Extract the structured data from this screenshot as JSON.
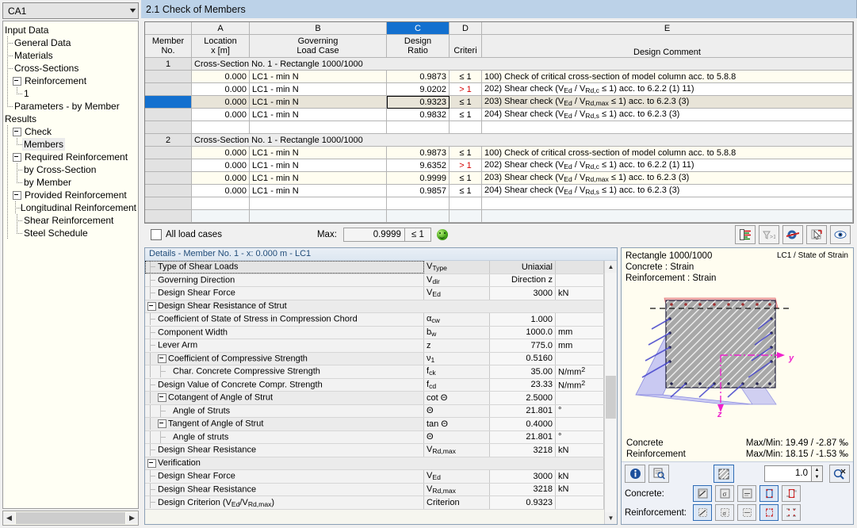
{
  "sidebar": {
    "combo_value": "CA1",
    "tree": [
      {
        "label": "Input Data",
        "level": 0,
        "guide": "none",
        "expander": false
      },
      {
        "label": "General Data",
        "level": 1,
        "guide": "tee",
        "expander": false
      },
      {
        "label": "Materials",
        "level": 1,
        "guide": "tee",
        "expander": false
      },
      {
        "label": "Cross-Sections",
        "level": 1,
        "guide": "tee",
        "expander": false
      },
      {
        "label": "Reinforcement",
        "level": 1,
        "guide": "exp",
        "expander": true
      },
      {
        "label": "1",
        "level": 2,
        "guide": "ell",
        "expander": false
      },
      {
        "label": "Parameters - by Member",
        "level": 1,
        "guide": "ell",
        "expander": false
      },
      {
        "label": "Results",
        "level": 0,
        "guide": "none",
        "expander": false
      },
      {
        "label": "Check",
        "level": 1,
        "guide": "exp",
        "expander": true
      },
      {
        "label": "Members",
        "level": 2,
        "guide": "ell",
        "expander": false,
        "selected": true
      },
      {
        "label": "Required Reinforcement",
        "level": 1,
        "guide": "exp",
        "expander": true
      },
      {
        "label": "by Cross-Section",
        "level": 2,
        "guide": "tee",
        "expander": false
      },
      {
        "label": "by Member",
        "level": 2,
        "guide": "ell",
        "expander": false
      },
      {
        "label": "Provided Reinforcement",
        "level": 1,
        "guide": "exp",
        "expander": true
      },
      {
        "label": "Longitudinal Reinforcement",
        "level": 2,
        "guide": "tee",
        "expander": false
      },
      {
        "label": "Shear Reinforcement",
        "level": 2,
        "guide": "tee",
        "expander": false
      },
      {
        "label": "Steel Schedule",
        "level": 2,
        "guide": "ell",
        "expander": false
      }
    ]
  },
  "main": {
    "tab_title": "2.1 Check of Members"
  },
  "grid": {
    "column_letters": [
      "",
      "A",
      "B",
      "C",
      "D",
      "E"
    ],
    "active_letter": "C",
    "headers": [
      {
        "l1": "Member",
        "l2": "No."
      },
      {
        "l1": "Location",
        "l2": "x [m]"
      },
      {
        "l1": "Governing",
        "l2": "Load Case"
      },
      {
        "l1": "Design",
        "l2": "Ratio"
      },
      {
        "l1": "",
        "l2": "Criteri"
      },
      {
        "l1": "",
        "l2": "Design Comment"
      }
    ],
    "groups": [
      {
        "member_no": "1",
        "group_label": "Cross-Section No. 1 - Rectangle 1000/1000",
        "rows": [
          {
            "loc": "0.000",
            "lc": "LC1 - min N",
            "ratio": "0.9873",
            "crit": "≤ 1",
            "fail": false,
            "comment_no": "100)",
            "comment": "Check of critical cross-section of model column acc. to 5.8.8",
            "comment_html": "100) Check of critical cross-section of model column acc. to 5.8.8"
          },
          {
            "loc": "0.000",
            "lc": "LC1 - min N",
            "ratio": "9.0202",
            "crit": "> 1",
            "fail": true,
            "comment_no": "202)",
            "comment": "Shear check (VEd / VRd,c ≤ 1) acc. to 6.2.2 (1) 11)",
            "comment_html": "202) Shear check (V<span class=\"sub\">Ed</span> / V<span class=\"sub\">Rd,c</span> ≤ 1) acc. to 6.2.2 (1) 11)"
          },
          {
            "loc": "0.000",
            "lc": "LC1 - min N",
            "ratio": "0.9323",
            "crit": "≤ 1",
            "fail": false,
            "selected": true,
            "comment_no": "203)",
            "comment": "Shear check  (VEd / VRd,max ≤ 1) acc. to 6.2.3 (3)",
            "comment_html": "203) Shear check  (V<span class=\"sub\">Ed</span> / V<span class=\"sub\">Rd,max</span> ≤ 1) acc. to 6.2.3 (3)"
          },
          {
            "loc": "0.000",
            "lc": "LC1 - min N",
            "ratio": "0.9832",
            "crit": "≤ 1",
            "fail": false,
            "comment_no": "204)",
            "comment": "Shear check (VEd / VRd,s ≤ 1) acc. to 6.2.3 (3)",
            "comment_html": "204) Shear check (V<span class=\"sub\">Ed</span> / V<span class=\"sub\">Rd,s</span> ≤ 1) acc. to 6.2.3 (3)"
          }
        ]
      },
      {
        "member_no": "2",
        "group_label": "Cross-Section No. 1 - Rectangle 1000/1000",
        "rows": [
          {
            "loc": "0.000",
            "lc": "LC1 - min N",
            "ratio": "0.9873",
            "crit": "≤ 1",
            "fail": false,
            "comment_no": "100)",
            "comment": "Check of critical cross-section of model column acc. to 5.8.8",
            "comment_html": "100) Check of critical cross-section of model column acc. to 5.8.8"
          },
          {
            "loc": "0.000",
            "lc": "LC1 - min N",
            "ratio": "9.6352",
            "crit": "> 1",
            "fail": true,
            "comment_no": "202)",
            "comment": "Shear check (VEd / VRd,c ≤ 1) acc. to 6.2.2 (1) 11)",
            "comment_html": "202) Shear check (V<span class=\"sub\">Ed</span> / V<span class=\"sub\">Rd,c</span> ≤ 1) acc. to 6.2.2 (1) 11)"
          },
          {
            "loc": "0.000",
            "lc": "LC1 - min N",
            "ratio": "0.9999",
            "crit": "≤ 1",
            "fail": false,
            "comment_no": "203)",
            "comment": "Shear check  (VEd / VRd,max ≤ 1) acc. to 6.2.3 (3)",
            "comment_html": "203) Shear check  (V<span class=\"sub\">Ed</span> / V<span class=\"sub\">Rd,max</span> ≤ 1) acc. to 6.2.3 (3)"
          },
          {
            "loc": "0.000",
            "lc": "LC1 - min N",
            "ratio": "0.9857",
            "crit": "≤ 1",
            "fail": false,
            "comment_no": "204)",
            "comment": "Shear check (VEd / VRd,s ≤ 1) acc. to 6.2.3 (3)",
            "comment_html": "204) Shear check (V<span class=\"sub\">Ed</span> / V<span class=\"sub\">Rd,s</span> ≤ 1) acc. to 6.2.3 (3)"
          }
        ]
      }
    ]
  },
  "gridfoot": {
    "all_load_cases_label": "All load cases",
    "all_load_cases_checked": false,
    "max_label": "Max:",
    "max_value": "0.9999",
    "max_criterion": "≤ 1"
  },
  "details": {
    "title": "Details  -  Member No. 1  -  x: 0.000 m  -  LC1",
    "rows": [
      {
        "kind": "leaf",
        "indent": 1,
        "name": "Type of Shear Loads",
        "sym": "VType",
        "sym_html": "V<span class=\"sub\">Type</span>",
        "val": "Uniaxial",
        "unit": "",
        "selected": true,
        "dotted": true
      },
      {
        "kind": "leaf",
        "indent": 1,
        "name": "Governing Direction",
        "sym": "Vdir",
        "sym_html": "V<span class=\"sub\">dir</span>",
        "val": "Direction z",
        "unit": ""
      },
      {
        "kind": "leaf",
        "indent": 1,
        "name": "Design Shear Force",
        "sym": "VEd",
        "sym_html": "V<span class=\"sub\">Ed</span>",
        "val": "3000",
        "unit": "kN"
      },
      {
        "kind": "group",
        "indent": 0,
        "name": "Design Shear Resistance of Strut",
        "sym": "",
        "val": "",
        "unit": ""
      },
      {
        "kind": "leaf",
        "indent": 1,
        "name": "Coefficient of State of Stress in Compression Chord",
        "sym": "αcw",
        "sym_html": "α<span class=\"sub\">cw</span>",
        "val": "1.000",
        "unit": ""
      },
      {
        "kind": "leaf",
        "indent": 1,
        "name": "Component Width",
        "sym": "bw",
        "sym_html": "b<span class=\"sub\">w</span>",
        "val": "1000.0",
        "unit": "mm"
      },
      {
        "kind": "leaf",
        "indent": 1,
        "name": "Lever Arm",
        "sym": "z",
        "sym_html": "z",
        "val": "775.0",
        "unit": "mm"
      },
      {
        "kind": "group",
        "indent": 1,
        "name": "Coefficient of Compressive Strength",
        "sym": "ν1",
        "sym_html": "ν<span class=\"sub\">1</span>",
        "val": "0.5160",
        "unit": ""
      },
      {
        "kind": "leaf",
        "indent": 2,
        "name": "Char. Concrete Compressive Strength",
        "sym": "fck",
        "sym_html": "f<span class=\"sub\">ck</span>",
        "val": "35.00",
        "unit": "N/mm2",
        "unit_html": "N/mm<span class=\"sup\">2</span>"
      },
      {
        "kind": "leaf",
        "indent": 1,
        "name": "Design Value of Concrete Compr. Strength",
        "sym": "fcd",
        "sym_html": "f<span class=\"sub\">cd</span>",
        "val": "23.33",
        "unit": "N/mm2",
        "unit_html": "N/mm<span class=\"sup\">2</span>"
      },
      {
        "kind": "group",
        "indent": 1,
        "name": "Cotangent of Angle of Strut",
        "sym": "cot Θ",
        "sym_html": "cot Θ",
        "val": "2.5000",
        "unit": ""
      },
      {
        "kind": "leaf",
        "indent": 2,
        "name": "Angle of Struts",
        "sym": "Θ",
        "sym_html": "Θ",
        "val": "21.801",
        "unit": "°"
      },
      {
        "kind": "group",
        "indent": 1,
        "name": "Tangent of Angle of Strut",
        "sym": "tan Θ",
        "sym_html": "tan Θ",
        "val": "0.4000",
        "unit": ""
      },
      {
        "kind": "leaf",
        "indent": 2,
        "name": "Angle of struts",
        "sym": "Θ",
        "sym_html": "Θ",
        "val": "21.801",
        "unit": "°"
      },
      {
        "kind": "leaf",
        "indent": 1,
        "name": "Design Shear Resistance",
        "sym": "VRd,max",
        "sym_html": "V<span class=\"sub\">Rd,max</span>",
        "val": "3218",
        "unit": "kN"
      },
      {
        "kind": "group",
        "indent": 0,
        "name": "Verification",
        "sym": "",
        "val": "",
        "unit": ""
      },
      {
        "kind": "leaf",
        "indent": 1,
        "name": "Design Shear Force",
        "sym": "VEd",
        "sym_html": "V<span class=\"sub\">Ed</span>",
        "val": "3000",
        "unit": "kN"
      },
      {
        "kind": "leaf",
        "indent": 1,
        "name": "Design Shear Resistance",
        "sym": "VRd,max",
        "sym_html": "V<span class=\"sub\">Rd,max</span>",
        "val": "3218",
        "unit": "kN"
      },
      {
        "kind": "leaf",
        "indent": 1,
        "name": "Design Criterion (VEd/VRd,max)",
        "name_html": "Design Criterion (V<span class=\"sub\">Ed</span>/V<span class=\"sub\">Rd,max</span>)",
        "sym": "Criterion",
        "sym_html": "Criterion",
        "val": "0.9323",
        "unit": ""
      }
    ]
  },
  "viewer": {
    "section_title": "Rectangle 1000/1000",
    "line2": "Concrete : Strain",
    "line3": "Reinforcement : Strain",
    "lc_label": "LC1 / State of Strain",
    "axis_y": "y",
    "axis_z": "z",
    "footer": [
      {
        "label": "Concrete",
        "value": "Max/Min: 19.49 / -2.87 ‰"
      },
      {
        "label": "Reinforcement",
        "value": "Max/Min: 18.15 / -1.53 ‰"
      }
    ],
    "zoom_value": "1.0",
    "concrete_label": "Concrete:",
    "reinforcement_label": "Reinforcement:"
  },
  "colors": {
    "tab_bg": "#bcd2e8",
    "selection": "#1370cf",
    "fail": "#d40000",
    "concrete_fill": "#a8a8a8",
    "strain_blue": "#7f7fe0",
    "strain_red": "#f2a0a0",
    "axis_magenta": "#ee22cc"
  }
}
